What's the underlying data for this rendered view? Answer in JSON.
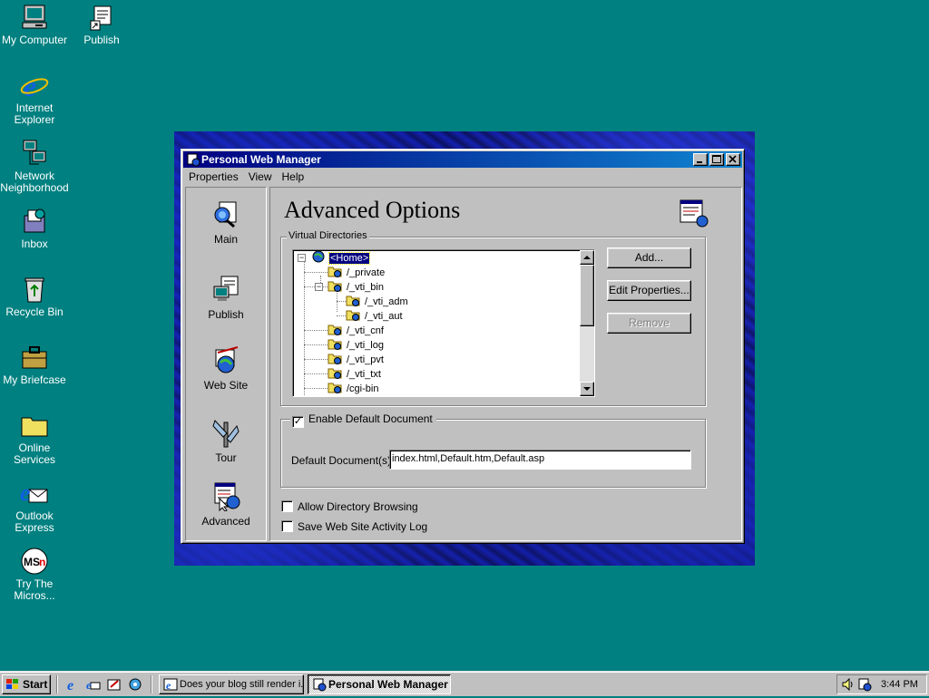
{
  "desktop": {
    "icons": [
      {
        "label": "My Computer"
      },
      {
        "label": "Publish"
      },
      {
        "label": "Internet Explorer"
      },
      {
        "label": "Network Neighborhood"
      },
      {
        "label": "Inbox"
      },
      {
        "label": "Recycle Bin"
      },
      {
        "label": "My Briefcase"
      },
      {
        "label": "Online Services"
      },
      {
        "label": "Outlook Express"
      },
      {
        "label": "Try The Micros..."
      }
    ]
  },
  "window": {
    "title": "Personal Web Manager",
    "title_icon": "pwm-icon",
    "menu": [
      "Properties",
      "View",
      "Help"
    ],
    "sidebar": [
      {
        "label": "Main",
        "icon": "main-icon"
      },
      {
        "label": "Publish",
        "icon": "publish-icon"
      },
      {
        "label": "Web Site",
        "icon": "web-site-icon"
      },
      {
        "label": "Tour",
        "icon": "tour-icon"
      },
      {
        "label": "Advanced",
        "icon": "advanced-icon"
      }
    ],
    "content": {
      "title": "Advanced Options",
      "virtual_directories_label": "Virtual Directories",
      "tree": [
        {
          "label": "<Home>",
          "selected": true
        },
        {
          "label": "/_private"
        },
        {
          "label": "/_vti_bin"
        },
        {
          "label": "/_vti_adm"
        },
        {
          "label": "/_vti_aut"
        },
        {
          "label": "/_vti_cnf"
        },
        {
          "label": "/_vti_log"
        },
        {
          "label": "/_vti_pvt"
        },
        {
          "label": "/_vti_txt"
        },
        {
          "label": "/cgi-bin"
        }
      ],
      "buttons": {
        "add": "Add...",
        "edit": "Edit Properties...",
        "remove": "Remove"
      },
      "enable_default_document": {
        "label": "Enable Default Document",
        "checked": true
      },
      "default_documents_label": "Default Document(s):",
      "default_documents_value": "index.html,Default.htm,Default.asp",
      "allow_directory_browsing": {
        "label": "Allow Directory Browsing",
        "checked": false
      },
      "save_activity_log": {
        "label": "Save Web Site Activity Log",
        "checked": false
      }
    }
  },
  "taskbar": {
    "start_label": "Start",
    "tasks": [
      {
        "label": "Does your blog still render i...",
        "active": false
      },
      {
        "label": "Personal Web Manager",
        "active": true
      }
    ],
    "clock": "3:44 PM"
  }
}
